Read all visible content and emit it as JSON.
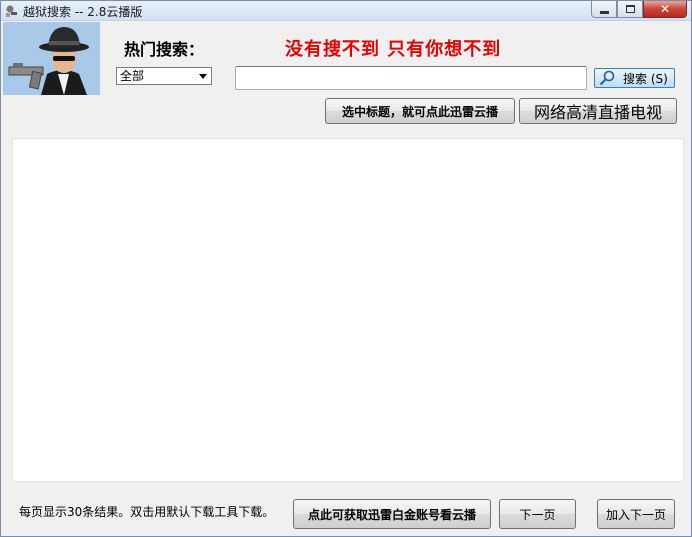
{
  "window": {
    "title": "越狱搜索 -- 2.8云播版",
    "close_glyph": "✕"
  },
  "header": {
    "hot_label": "热门搜索：",
    "slogan": "没有搜不到  只有你想不到",
    "logo": "detective-with-gun-logo"
  },
  "search": {
    "category_selected": "全部",
    "query_value": "",
    "placeholder": "",
    "button_label": "搜索 (S)"
  },
  "actions": {
    "xunlei_label": "选中标题，就可点此迅雷云播",
    "tv_label": "网络高清直播电视"
  },
  "results": {
    "items": []
  },
  "footer": {
    "note": "每页显示30条结果。双击用默认下载工具下载。",
    "account_button": "点此可获取迅雷白金账号看云播",
    "next_button": "下一页",
    "add_next_button": "加入下一页"
  },
  "colors": {
    "slogan": "#e60000",
    "search_accent": "#3c7fb1"
  }
}
